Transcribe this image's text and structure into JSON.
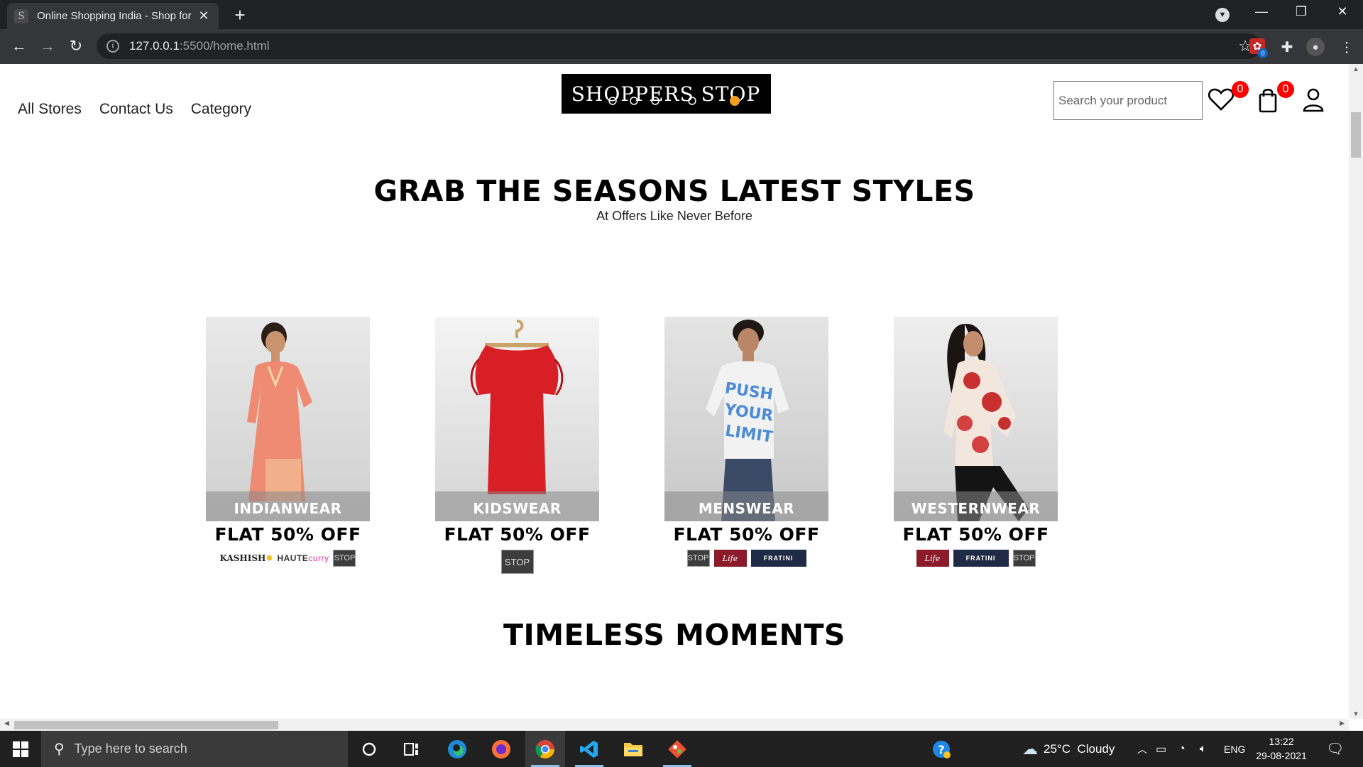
{
  "browser": {
    "tab_title": "Online Shopping India - Shop for",
    "tab_favicon": "S",
    "url_host": "127.0.0.1",
    "url_rest": ":5500/home.html",
    "extension_badge": "0"
  },
  "site": {
    "nav": [
      "All Stores",
      "Contact Us",
      "Category"
    ],
    "logo_text": "SHOPPERS STOP",
    "search_placeholder": "Search your product",
    "wishlist_count": "0",
    "cart_count": "0",
    "headline": "GRAB THE SEASONS LATEST STYLES",
    "subheadline": "At Offers Like Never Before",
    "cards": [
      {
        "category": "INDIANWEAR",
        "offer": "FLAT 50% OFF",
        "brands": [
          "KASHISH",
          "HAUTE",
          "curry",
          "STOP"
        ]
      },
      {
        "category": "KIDSWEAR",
        "offer": "FLAT 50% OFF",
        "brands": [
          "STOP"
        ]
      },
      {
        "category": "MENSWEAR",
        "offer": "FLAT 50% OFF",
        "brands": [
          "STOP",
          "Life",
          "FRATINI"
        ]
      },
      {
        "category": "WESTERNWEAR",
        "offer": "FLAT 50% OFF",
        "brands": [
          "Life",
          "FRATINI",
          "STOP"
        ]
      }
    ],
    "section_title": "TIMELESS MOMENTS"
  },
  "taskbar": {
    "search_placeholder": "Type here to search",
    "weather": "25°C  Cloudy",
    "language": "ENG",
    "time": "13:22",
    "date": "29-08-2021"
  },
  "colors": {
    "badge": "#ff0000",
    "chrome_dark": "#202124",
    "chrome_toolbar": "#35363a",
    "taskbar": "#202020"
  }
}
